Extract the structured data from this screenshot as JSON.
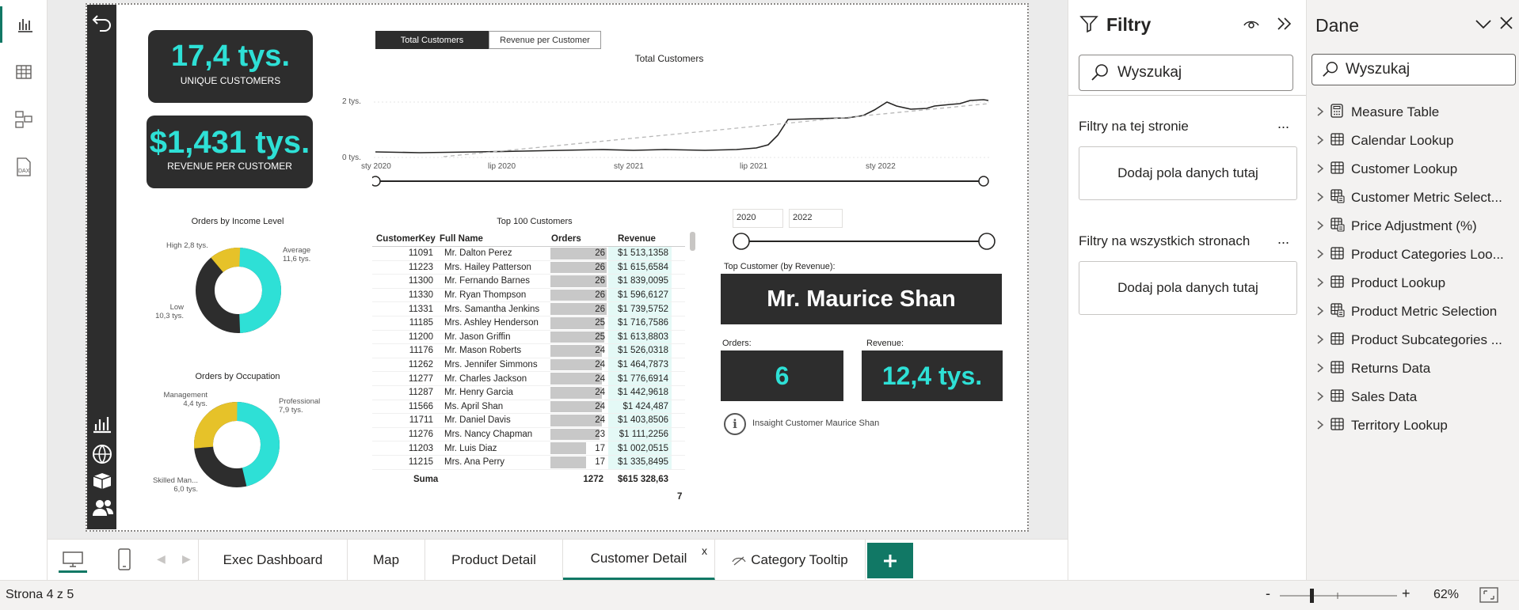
{
  "kpis": {
    "unique_value": "17,4 tys.",
    "unique_label": "UNIQUE CUSTOMERS",
    "rev_value": "$1,431 tys.",
    "rev_label": "REVENUE PER CUSTOMER"
  },
  "toggle": {
    "a": "Total Customers",
    "b": "Revenue per Customer"
  },
  "line_chart": {
    "title": "Total Customers",
    "y_labels": [
      "2 tys.",
      "0 tys."
    ],
    "x_labels": [
      "sty 2020",
      "lip 2020",
      "sty 2021",
      "lip 2021",
      "sty 2022"
    ]
  },
  "donut1": {
    "title": "Orders by Income Level",
    "labels": [
      {
        "name": "High",
        "value": "2,8 tys."
      },
      {
        "name": "Average",
        "value": "11,6 tys."
      },
      {
        "name": "Low",
        "value": "10,3 tys."
      }
    ]
  },
  "donut2": {
    "title": "Orders by Occupation",
    "labels": [
      {
        "name": "Management",
        "value": "4,4 tys."
      },
      {
        "name": "Professional",
        "value": "7,9 tys."
      },
      {
        "name": "Skilled Man...",
        "value": "6,0 tys."
      }
    ]
  },
  "table": {
    "title": "Top 100 Customers",
    "headers": [
      "CustomerKey",
      "Full Name",
      "Orders",
      "Revenue"
    ],
    "rows": [
      [
        "11091",
        "Mr. Dalton Perez",
        "26",
        "$1 513,1358"
      ],
      [
        "11223",
        "Mrs. Hailey Patterson",
        "26",
        "$1 615,6584"
      ],
      [
        "11300",
        "Mr. Fernando Barnes",
        "26",
        "$1 839,0095"
      ],
      [
        "11330",
        "Mr. Ryan Thompson",
        "26",
        "$1 596,6127"
      ],
      [
        "11331",
        "Mrs. Samantha Jenkins",
        "26",
        "$1 739,5752"
      ],
      [
        "11185",
        "Mrs. Ashley Henderson",
        "25",
        "$1 716,7586"
      ],
      [
        "11200",
        "Mr. Jason Griffin",
        "25",
        "$1 613,8803"
      ],
      [
        "11176",
        "Mr. Mason Roberts",
        "24",
        "$1 526,0318"
      ],
      [
        "11262",
        "Mrs. Jennifer Simmons",
        "24",
        "$1 464,7873"
      ],
      [
        "11277",
        "Mr. Charles Jackson",
        "24",
        "$1 776,6914"
      ],
      [
        "11287",
        "Mr. Henry Garcia",
        "24",
        "$1 442,9618"
      ],
      [
        "11566",
        "Ms. April Shan",
        "24",
        "$1 424,487"
      ],
      [
        "11711",
        "Mr. Daniel Davis",
        "24",
        "$1 403,8506"
      ],
      [
        "11276",
        "Mrs. Nancy Chapman",
        "23",
        "$1 111,2256"
      ],
      [
        "11203",
        "Mr. Luis Diaz",
        "17",
        "$1 002,0515"
      ],
      [
        "11215",
        "Mrs. Ana Perry",
        "17",
        "$1 335,8495"
      ]
    ],
    "total_label": "Suma",
    "total_orders": "1272",
    "total_revenue": "$615 328,63",
    "total_revenue_wrap": "7"
  },
  "year_slicer": {
    "from": "2020",
    "to": "2022"
  },
  "top_customer": {
    "label": "Top Customer (by Revenue):",
    "name": "Mr. Maurice Shan",
    "orders_label": "Orders:",
    "orders_value": "6",
    "revenue_label": "Revenue:",
    "revenue_value": "12,4 tys.",
    "insight": "Insaight Customer Maurice Shan"
  },
  "filters": {
    "title": "Filtry",
    "search": "Wyszukaj",
    "this_page": "Filtry na tej stronie",
    "all_pages": "Filtry na wszystkich stronach",
    "drop": "Dodaj pola danych tutaj",
    "more": "..."
  },
  "data_pane": {
    "title": "Dane",
    "search": "Wyszukaj",
    "items": [
      {
        "label": "Measure Table",
        "icon": "calculator"
      },
      {
        "label": "Calendar Lookup",
        "icon": "table"
      },
      {
        "label": "Customer Lookup",
        "icon": "table"
      },
      {
        "label": "Customer Metric Select...",
        "icon": "param-table"
      },
      {
        "label": "Price Adjustment (%)",
        "icon": "param-table"
      },
      {
        "label": "Product Categories Loo...",
        "icon": "table"
      },
      {
        "label": "Product Lookup",
        "icon": "table"
      },
      {
        "label": "Product Metric Selection",
        "icon": "param-table"
      },
      {
        "label": "Product Subcategories ...",
        "icon": "table"
      },
      {
        "label": "Returns Data",
        "icon": "table"
      },
      {
        "label": "Sales Data",
        "icon": "table"
      },
      {
        "label": "Territory Lookup",
        "icon": "table"
      }
    ]
  },
  "tabs": [
    {
      "label": "Exec Dashboard"
    },
    {
      "label": "Map"
    },
    {
      "label": "Product Detail"
    },
    {
      "label": "Customer Detail"
    },
    {
      "label": "Category Tooltip"
    }
  ],
  "tab_close": "x",
  "status": {
    "page": "Strona 4 z 5",
    "zoom": "62%",
    "minus": "-",
    "plus": "+"
  },
  "colors": {
    "accent": "#117865",
    "teal": "#2ee0d6",
    "gold": "#e6c229",
    "dark": "#2d2d2d"
  }
}
